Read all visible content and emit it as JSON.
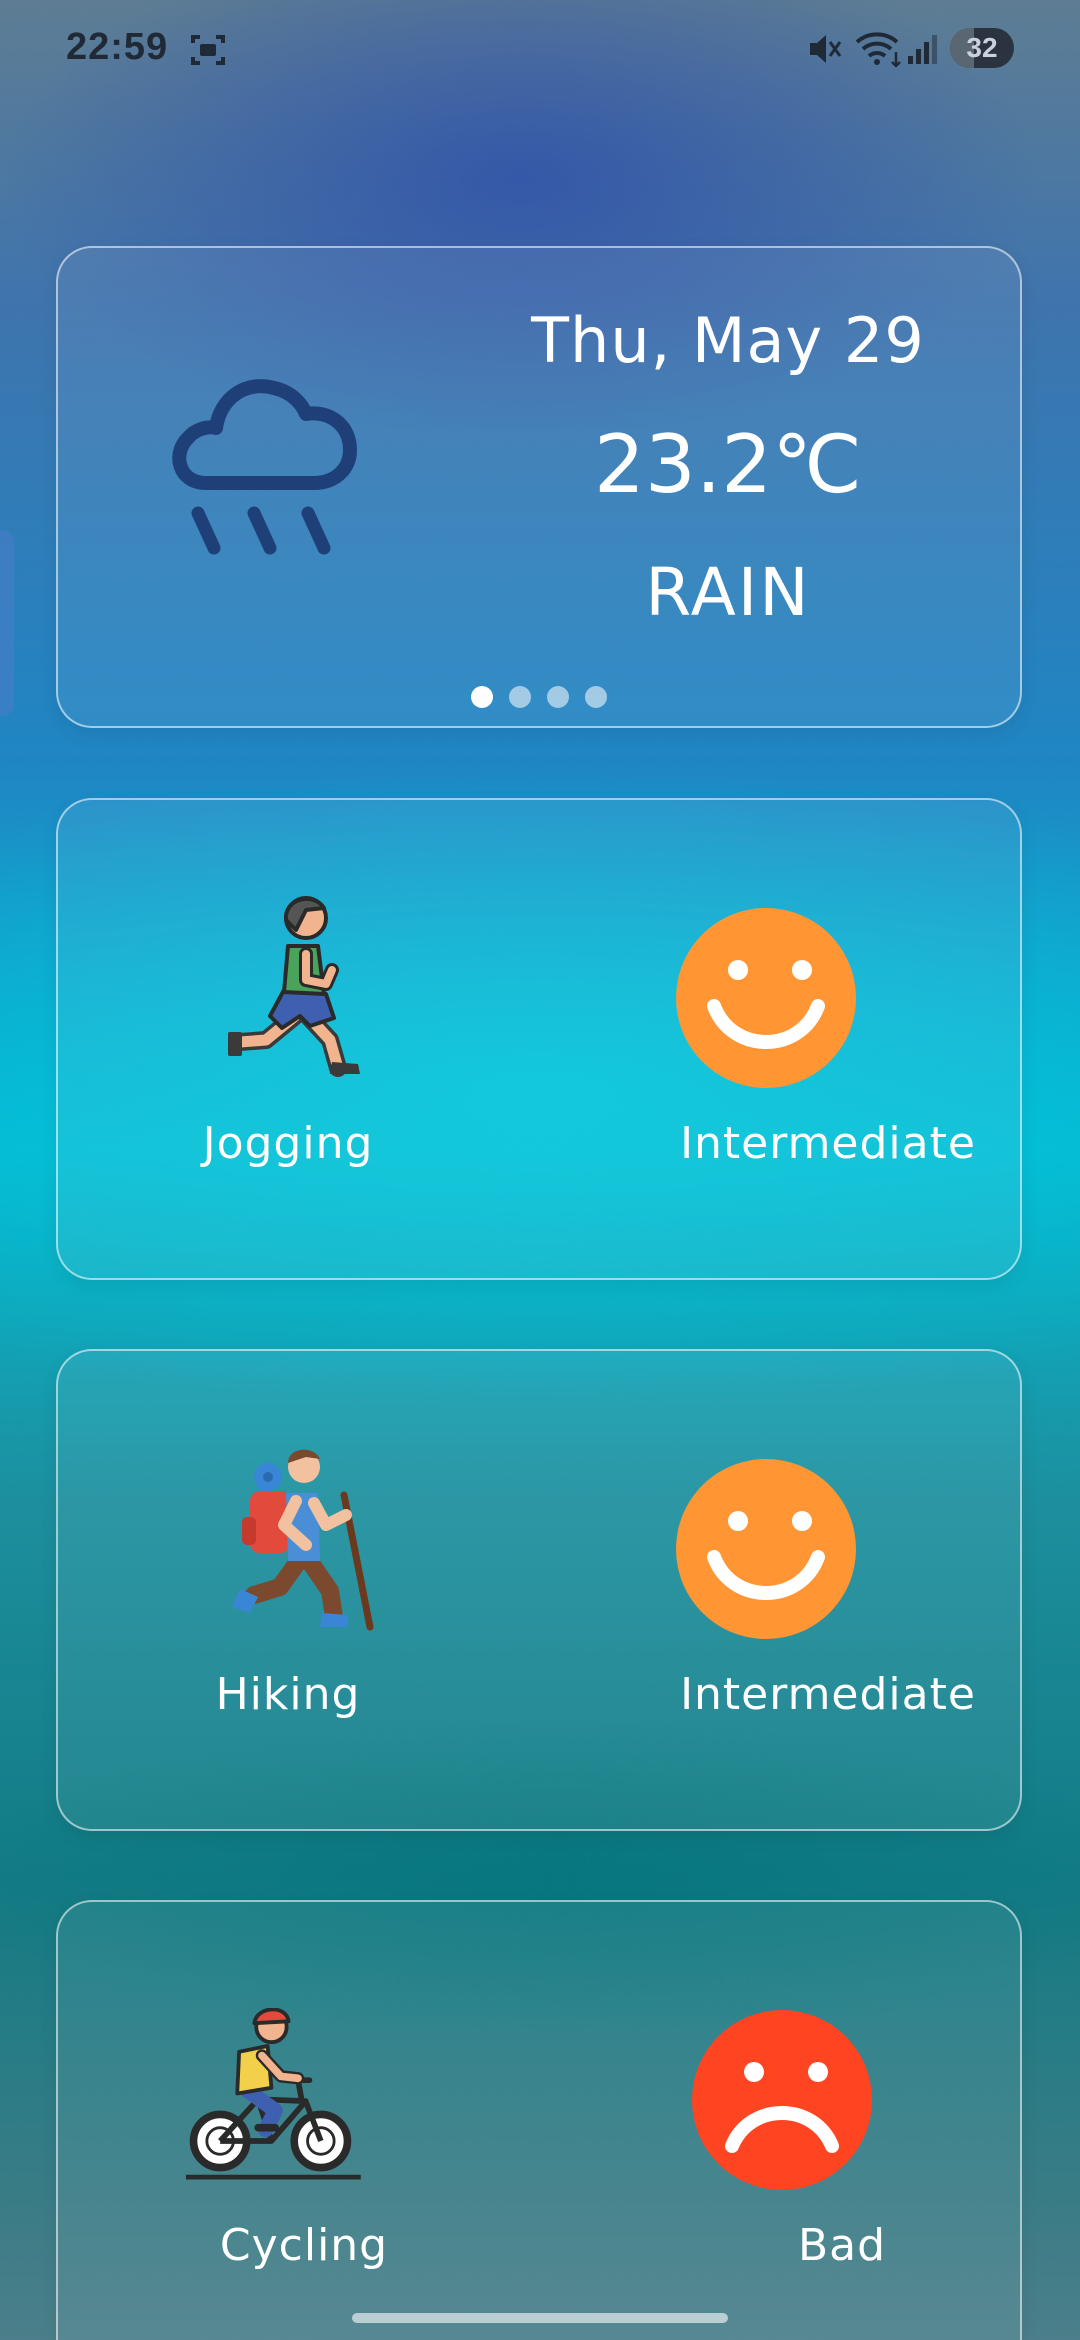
{
  "status_bar": {
    "time": "22:59",
    "battery": "32",
    "icons": [
      "screenshot-icon",
      "mute-icon",
      "wifi-icon",
      "signal-icon",
      "battery-icon"
    ]
  },
  "weather": {
    "date": "Thu, May 29",
    "temperature": "23.2℃",
    "condition": "RAIN",
    "icon": "rain-cloud-icon",
    "pager": {
      "pages": 4,
      "active_index": 0
    }
  },
  "activities": [
    {
      "name": "Jogging",
      "level": "Intermediate",
      "icon": "runner-icon",
      "face": "smile-face-icon",
      "face_color": "#FF9633"
    },
    {
      "name": "Hiking",
      "level": "Intermediate",
      "icon": "hiker-icon",
      "face": "smile-face-icon",
      "face_color": "#FF9633"
    },
    {
      "name": "Cycling",
      "level": "Bad",
      "icon": "cyclist-icon",
      "face": "sad-face-icon",
      "face_color": "#FF4422"
    }
  ],
  "colors": {
    "accent_orange": "#FF9633",
    "accent_red": "#FF4422",
    "rain_icon": "#1F3F78"
  }
}
